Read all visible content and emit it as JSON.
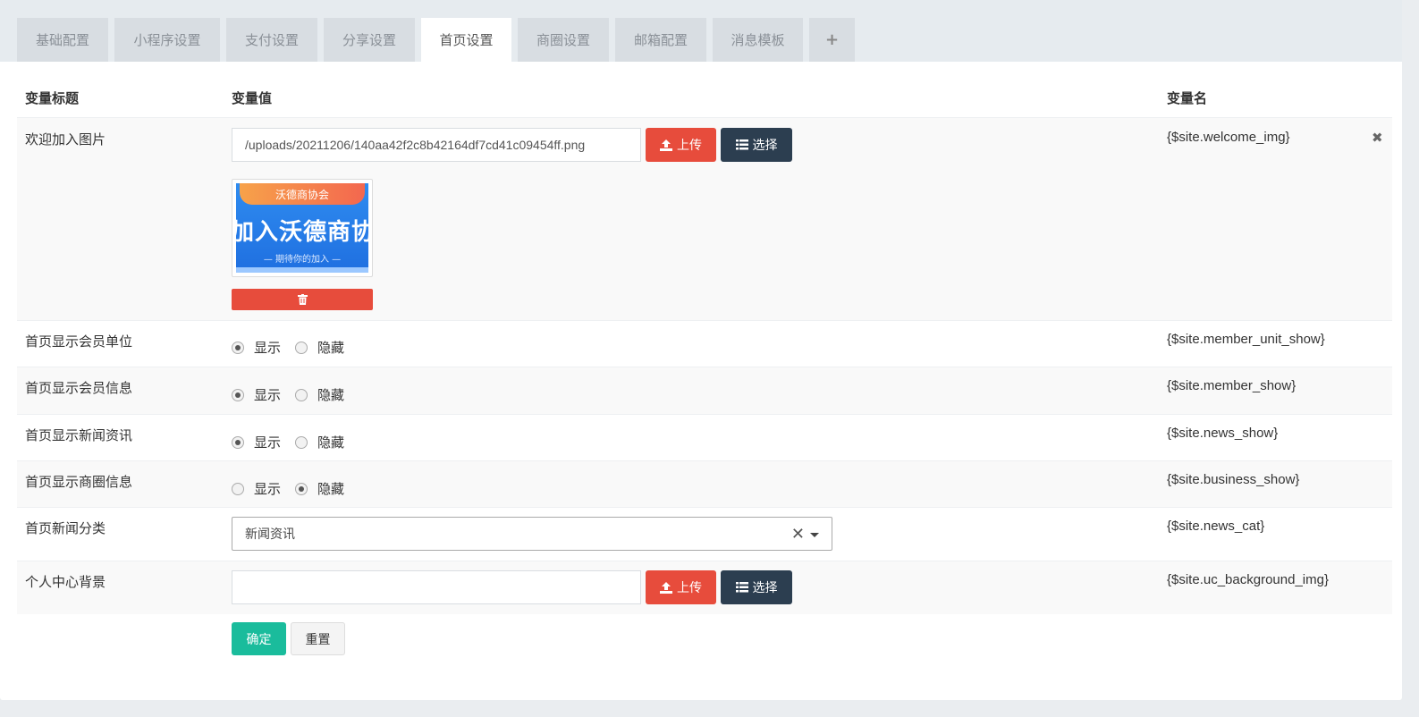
{
  "tabs": [
    {
      "label": "基础配置",
      "active": false
    },
    {
      "label": "小程序设置",
      "active": false
    },
    {
      "label": "支付设置",
      "active": false
    },
    {
      "label": "分享设置",
      "active": false
    },
    {
      "label": "首页设置",
      "active": true
    },
    {
      "label": "商圈设置",
      "active": false
    },
    {
      "label": "邮箱配置",
      "active": false
    },
    {
      "label": "消息模板",
      "active": false
    }
  ],
  "add_tab_label": "+",
  "header": {
    "col_title": "变量标题",
    "col_value": "变量值",
    "col_name": "变量名"
  },
  "rows": {
    "welcome_img": {
      "label": "欢迎加入图片",
      "value": "/uploads/20211206/140aa42f2c8b42164df7cd41c09454ff.png",
      "varname": "{$site.welcome_img}",
      "preview": {
        "banner_text": "沃德商协会",
        "main_text": "加入沃德商协",
        "sub_text": "— 期待你的加入 —"
      }
    },
    "member_unit_show": {
      "label": "首页显示会员单位",
      "selected": "显示",
      "varname": "{$site.member_unit_show}"
    },
    "member_show": {
      "label": "首页显示会员信息",
      "selected": "显示",
      "varname": "{$site.member_show}"
    },
    "news_show": {
      "label": "首页显示新闻资讯",
      "selected": "显示",
      "varname": "{$site.news_show}"
    },
    "business_show": {
      "label": "首页显示商圈信息",
      "selected": "隐藏",
      "varname": "{$site.business_show}"
    },
    "news_cat": {
      "label": "首页新闻分类",
      "value": "新闻资讯",
      "varname": "{$site.news_cat}"
    },
    "uc_background_img": {
      "label": "个人中心背景",
      "value": "",
      "varname": "{$site.uc_background_img}"
    }
  },
  "radio_options": {
    "show": "显示",
    "hide": "隐藏"
  },
  "buttons": {
    "upload": "上传",
    "select": "选择",
    "confirm": "确定",
    "reset": "重置"
  },
  "colors": {
    "danger": "#e74c3c",
    "dark": "#2c3e50",
    "success": "#1abc9c"
  }
}
